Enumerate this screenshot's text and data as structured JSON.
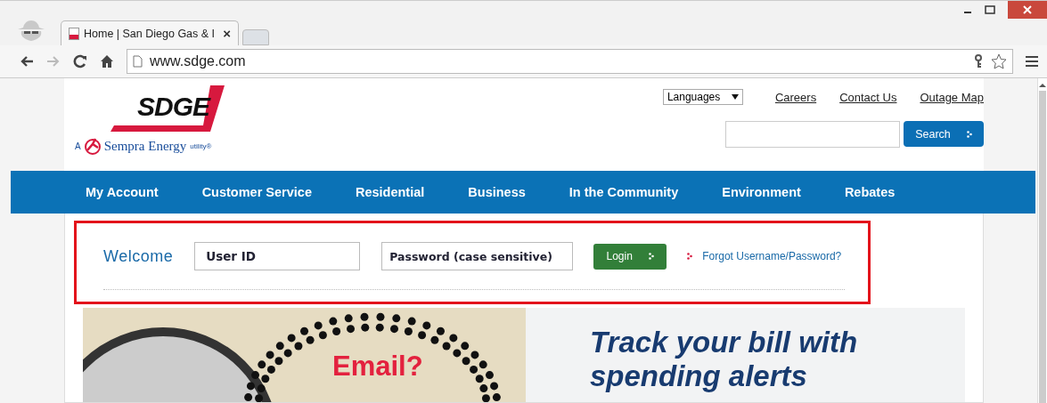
{
  "browser": {
    "tab_title": "Home | San Diego Gas & I",
    "tab_close": "×",
    "url": "www.sdge.com"
  },
  "logo": {
    "wordmark": "SDGE",
    "prefix": "A",
    "company": "Sempra Energy",
    "suffix": "utility®"
  },
  "header": {
    "language_select": "Languages",
    "links": [
      "Careers",
      "Contact Us",
      "Outage Map"
    ],
    "search_button": "Search"
  },
  "nav": [
    "My Account",
    "Customer Service",
    "Residential",
    "Business",
    "In the Community",
    "Environment",
    "Rebates"
  ],
  "login": {
    "welcome": "Welcome",
    "user_id": {
      "placeholder": "User ID"
    },
    "password": {
      "placeholder": "Password (case sensitive)"
    },
    "login_button": "Login",
    "forgot_link": "Forgot Username/Password?",
    "highlighted": true
  },
  "banner": {
    "callout": "Email?",
    "headline": "Track your bill with spending alerts"
  }
}
